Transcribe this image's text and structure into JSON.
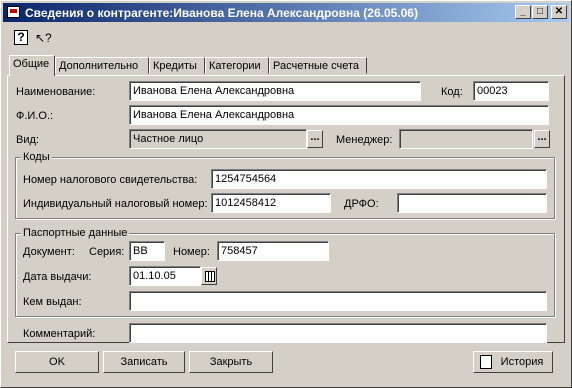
{
  "window": {
    "title": "Сведения о контрагенте:Иванова Елена Александровна (26.05.06)",
    "min": "_",
    "max": "□",
    "close": "✕"
  },
  "toolbar": {
    "help": "?",
    "whats_this": "↖?"
  },
  "tabs": [
    "Общие",
    "Дополнительно",
    "Кредиты",
    "Категории",
    "Расчетные счета"
  ],
  "general": {
    "name_label": "Наименование:",
    "name_value": "Иванова Елена Александровна",
    "code_label": "Код:",
    "code_value": "00023",
    "fio_label": "Ф.И.О.:",
    "fio_value": "Иванова Елена Александровна",
    "kind_label": "Вид:",
    "kind_value": "Частное лицо",
    "manager_label": "Менеджер:",
    "manager_value": "",
    "dots": "..."
  },
  "codes": {
    "title": "Коды",
    "tax_cert_label": "Номер налогового свидетельства:",
    "tax_cert_value": "1254754564",
    "inn_label": "Индивидуальный налоговый номер:",
    "inn_value": "1012458412",
    "drfo_label": "ДРФО:",
    "drfo_value": ""
  },
  "passport": {
    "title": "Паспортные данные",
    "doc_label": "Документ:",
    "series_label": "Серия:",
    "series_value": "ВВ",
    "number_label": "Номер:",
    "number_value": "758457",
    "date_label": "Дата выдачи:",
    "date_value": "01.10.05",
    "issued_label": "Кем выдан:",
    "issued_value": ""
  },
  "comment": {
    "label": "Комментарий:",
    "value": ""
  },
  "buttons": {
    "ok": "OK",
    "save": "Записать",
    "close": "Закрыть",
    "history": "История"
  }
}
